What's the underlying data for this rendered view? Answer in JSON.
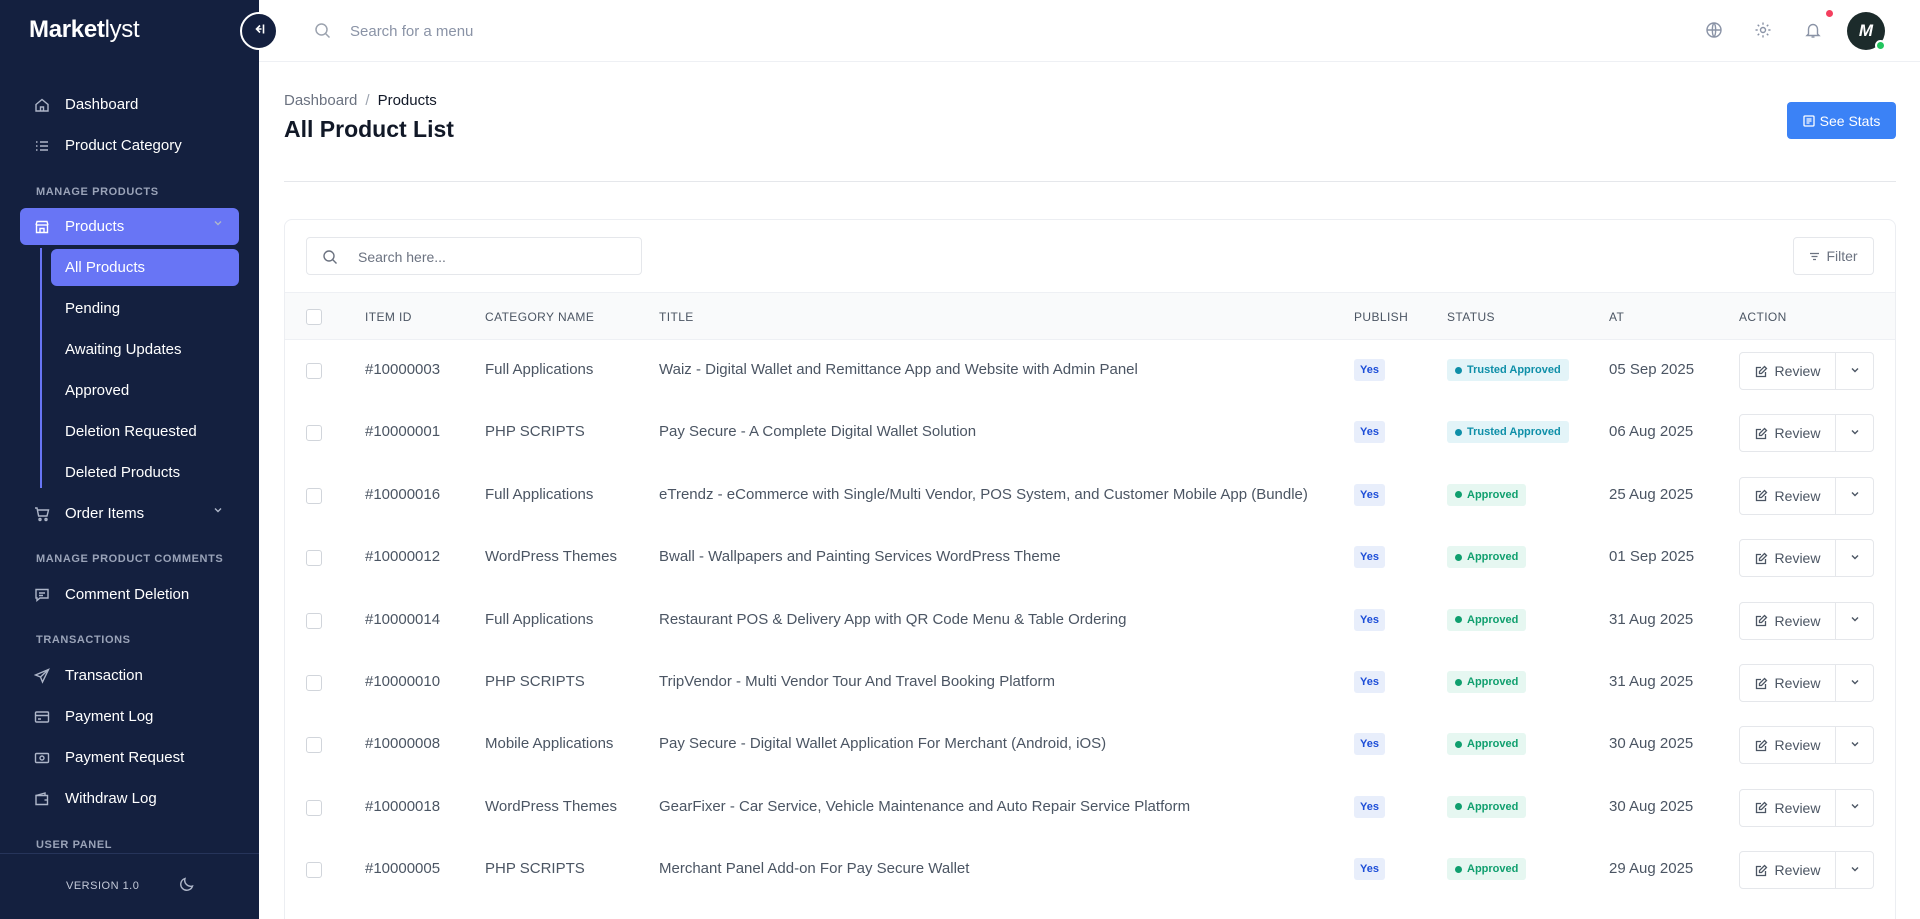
{
  "app": {
    "logo_bold": "Market",
    "logo_thin": "lyst",
    "version": "VERSION 1.0"
  },
  "topbar": {
    "search_placeholder": "Search for a menu",
    "avatar_initial": "M"
  },
  "sidebar": {
    "dashboard": "Dashboard",
    "product_category": "Product Category",
    "section_manage_products": "MANAGE PRODUCTS",
    "products": "Products",
    "sub_items": [
      "All Products",
      "Pending",
      "Awaiting Updates",
      "Approved",
      "Deletion Requested",
      "Deleted Products"
    ],
    "order_items": "Order Items",
    "section_manage_comments": "MANAGE PRODUCT COMMENTS",
    "comment_deletion": "Comment Deletion",
    "section_transactions": "TRANSACTIONS",
    "transaction": "Transaction",
    "payment_log": "Payment Log",
    "payment_request": "Payment Request",
    "withdraw_log": "Withdraw Log",
    "section_user_panel": "USER PANEL"
  },
  "page": {
    "breadcrumb_home": "Dashboard",
    "breadcrumb_sep": "/",
    "breadcrumb_current": "Products",
    "title": "All Product List",
    "see_stats": "See Stats"
  },
  "table": {
    "search_placeholder": "Search here...",
    "filter_label": "Filter",
    "columns": {
      "item_id": "ITEM ID",
      "category": "CATEGORY NAME",
      "title": "TITLE",
      "publish": "PUBLISH",
      "status": "STATUS",
      "at": "AT",
      "action": "ACTION"
    },
    "review_label": "Review",
    "rows": [
      {
        "id": "#10000003",
        "category": "Full Applications",
        "title": "Waiz - Digital Wallet and Remittance App and Website with Admin Panel",
        "publish": "Yes",
        "status": "Trusted Approved",
        "at": "05 Sep 2025"
      },
      {
        "id": "#10000001",
        "category": "PHP SCRIPTS",
        "title": "Pay Secure - A Complete Digital Wallet Solution",
        "publish": "Yes",
        "status": "Trusted Approved",
        "at": "06 Aug 2025"
      },
      {
        "id": "#10000016",
        "category": "Full Applications",
        "title": "eTrendz - eCommerce with Single/Multi Vendor, POS System, and Customer Mobile App (Bundle)",
        "publish": "Yes",
        "status": "Approved",
        "at": "25 Aug 2025"
      },
      {
        "id": "#10000012",
        "category": "WordPress Themes",
        "title": "Bwall - Wallpapers and Painting Services WordPress Theme",
        "publish": "Yes",
        "status": "Approved",
        "at": "01 Sep 2025"
      },
      {
        "id": "#10000014",
        "category": "Full Applications",
        "title": "Restaurant POS & Delivery App with QR Code Menu & Table Ordering",
        "publish": "Yes",
        "status": "Approved",
        "at": "31 Aug 2025"
      },
      {
        "id": "#10000010",
        "category": "PHP SCRIPTS",
        "title": "TripVendor - Multi Vendor Tour And Travel Booking Platform",
        "publish": "Yes",
        "status": "Approved",
        "at": "31 Aug 2025"
      },
      {
        "id": "#10000008",
        "category": "Mobile Applications",
        "title": "Pay Secure - Digital Wallet Application For Merchant (Android, iOS)",
        "publish": "Yes",
        "status": "Approved",
        "at": "30 Aug 2025"
      },
      {
        "id": "#10000018",
        "category": "WordPress Themes",
        "title": "GearFixer - Car Service, Vehicle Maintenance and Auto Repair Service Platform",
        "publish": "Yes",
        "status": "Approved",
        "at": "30 Aug 2025"
      },
      {
        "id": "#10000005",
        "category": "PHP SCRIPTS",
        "title": "Merchant Panel Add-on For Pay Secure Wallet",
        "publish": "Yes",
        "status": "Approved",
        "at": "29 Aug 2025"
      }
    ]
  },
  "colors": {
    "sidebar_bg": "#14203f",
    "accent": "#6875f5",
    "primary_button": "#3b82f6",
    "approved": "#0f9f6e",
    "trusted": "#0e8fa8"
  }
}
